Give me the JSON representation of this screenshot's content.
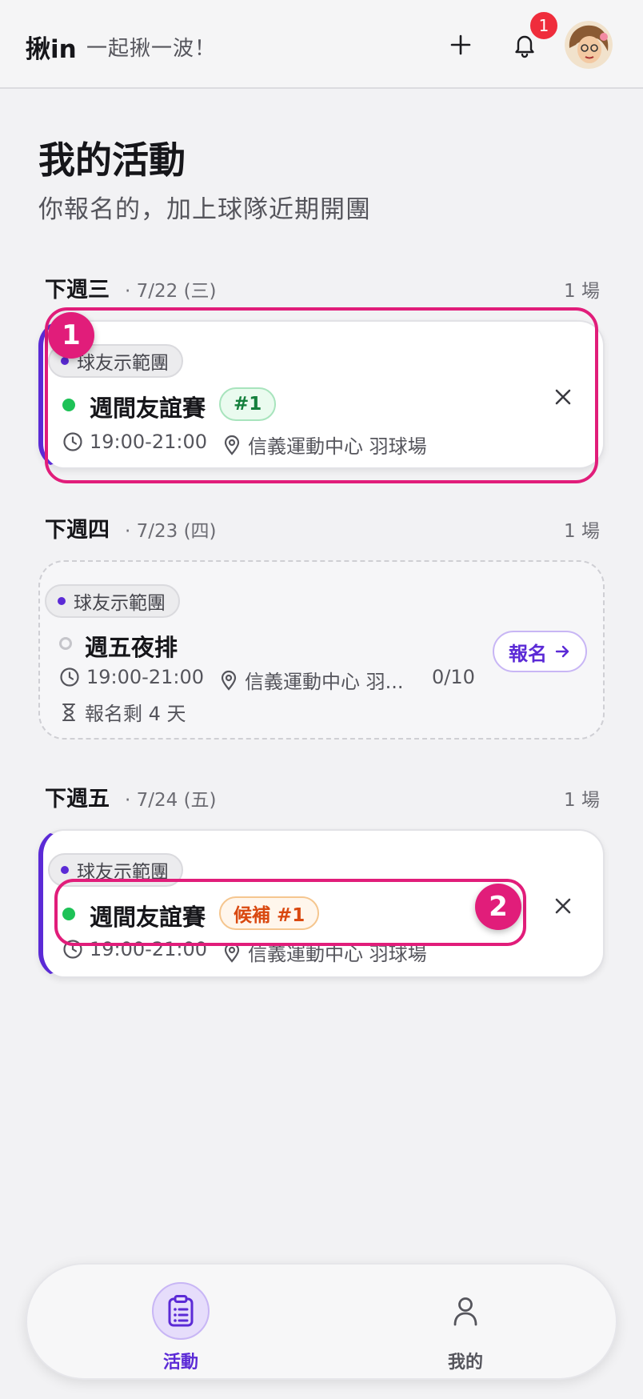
{
  "header": {
    "brand": "揪in",
    "tagline": "一起揪一波！",
    "notification_count": "1",
    "icons": [
      "plus-icon",
      "bell-icon"
    ]
  },
  "page": {
    "title": "我的活動",
    "subtitle": "你報名的，加上球隊近期開團"
  },
  "days": [
    {
      "name": "下週三",
      "date": "· 7/22 (三)",
      "count": "1 場",
      "event": {
        "team": "球友示範團",
        "title": "週間友誼賽",
        "tag": "#1",
        "time": "19:00-21:00",
        "location": "信義運動中心 羽球場"
      }
    },
    {
      "name": "下週四",
      "date": "· 7/23 (四)",
      "count": "1 場",
      "event": {
        "team": "球友示範團",
        "title": "週五夜排",
        "time": "19:00-21:00",
        "location": "信義運動中心 羽...",
        "capacity": "0/10",
        "deadline": "報名剩 4 天",
        "signup_label": "報名"
      }
    },
    {
      "name": "下週五",
      "date": "· 7/24 (五)",
      "count": "1 場",
      "event": {
        "team": "球友示範團",
        "title": "週間友誼賽",
        "tag": "候補 #1",
        "time": "19:00-21:00",
        "location": "信義運動中心 羽球場"
      }
    }
  ],
  "tutorial": {
    "step1": "1",
    "step2": "2",
    "highlight_color": "#e11d7a"
  },
  "nav": {
    "items": [
      {
        "label": "活動",
        "icon": "clipboard-icon",
        "active": true
      },
      {
        "label": "我的",
        "icon": "user-icon",
        "active": false
      }
    ]
  },
  "colors": {
    "accent": "#5b2ad6",
    "status_green": "#1ec257",
    "badge_red": "#ef2d3c"
  }
}
